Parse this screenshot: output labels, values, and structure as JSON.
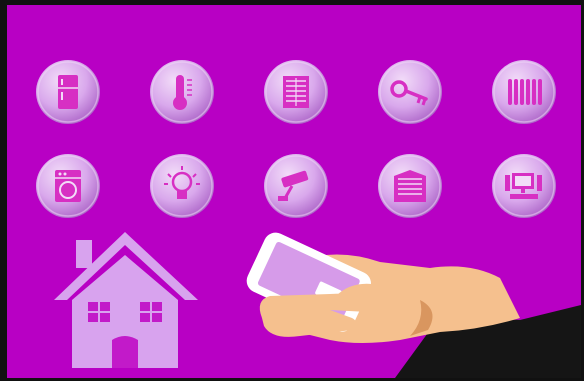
{
  "colors": {
    "background": "#b800c4",
    "frame": "#111111",
    "button_fill": "#d9a8ec",
    "button_highlight": "#f2dcf8",
    "button_shadow": "#a85fc4",
    "icon": "#d72fc3",
    "house": "#d8a3ee",
    "house_detail": "#c21ac9",
    "skin": "#f5c08e",
    "skin_shadow": "#d9965f",
    "sleeve": "#151515",
    "phone_body": "#ffffff",
    "phone_screen": "#d69be9"
  },
  "icons": [
    {
      "row": 1,
      "name": "refrigerator-icon"
    },
    {
      "row": 1,
      "name": "thermometer-icon"
    },
    {
      "row": 1,
      "name": "window-blinds-icon"
    },
    {
      "row": 1,
      "name": "key-icon"
    },
    {
      "row": 1,
      "name": "radiator-icon"
    },
    {
      "row": 2,
      "name": "washing-machine-icon"
    },
    {
      "row": 2,
      "name": "light-bulb-icon"
    },
    {
      "row": 2,
      "name": "security-camera-icon"
    },
    {
      "row": 2,
      "name": "garage-door-icon"
    },
    {
      "row": 2,
      "name": "computer-icon"
    }
  ]
}
